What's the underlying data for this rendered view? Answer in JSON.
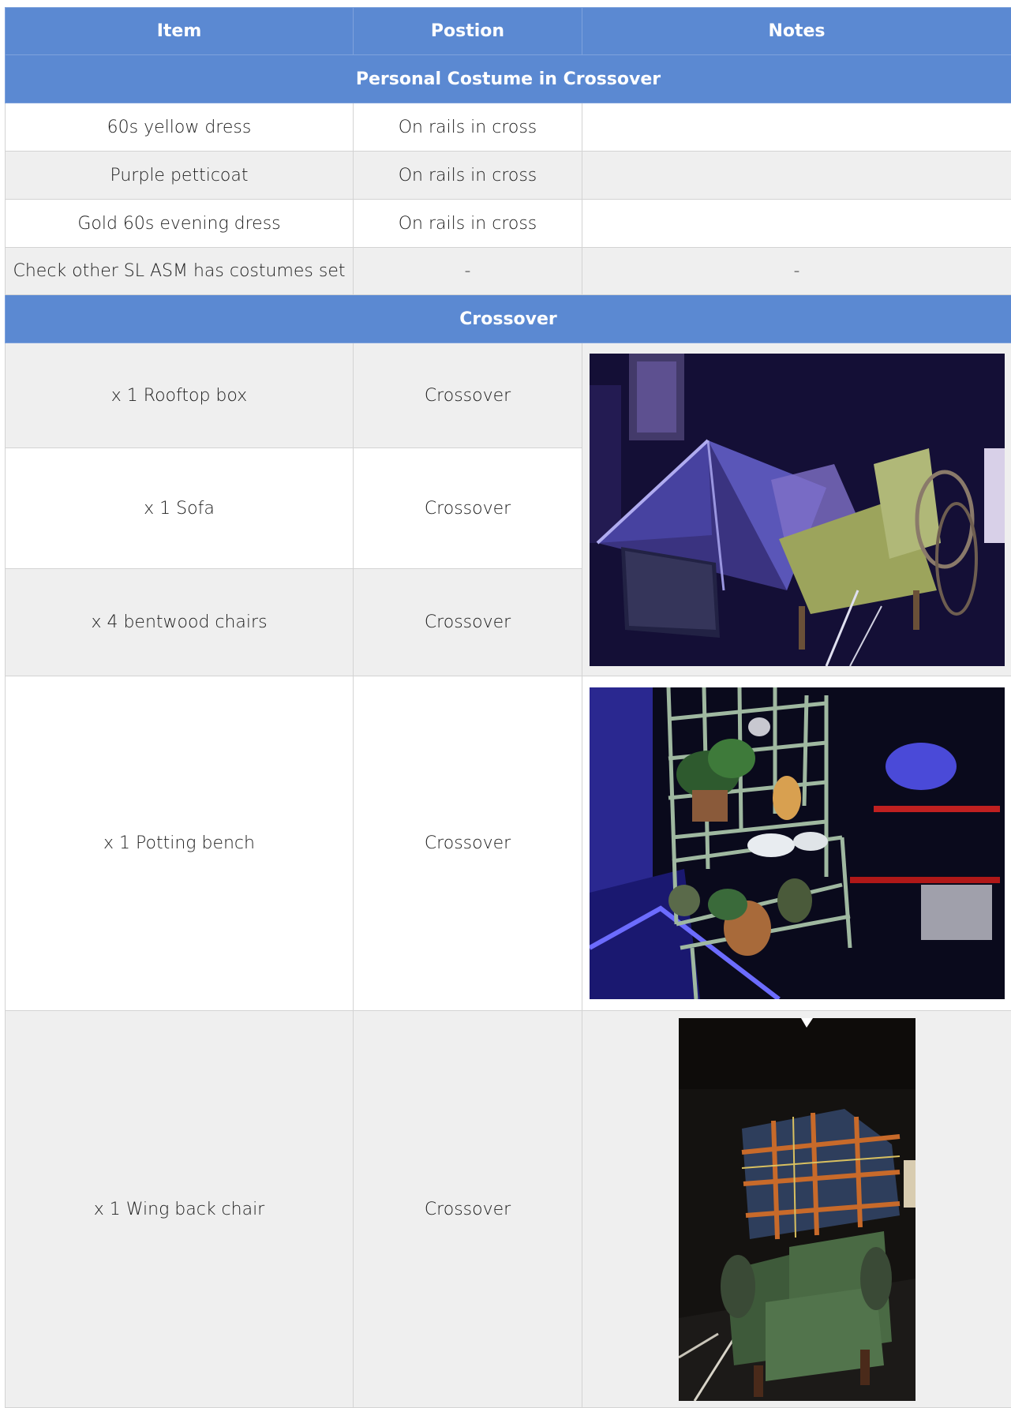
{
  "table": {
    "headers": [
      "Item",
      "Postion",
      "Notes"
    ],
    "sections": [
      {
        "title": "Personal Costume in Crossover",
        "rows": [
          {
            "item": "60s yellow dress",
            "position": "On rails in cross",
            "notes": ""
          },
          {
            "item": "Purple petticoat",
            "position": "On rails in cross",
            "notes": ""
          },
          {
            "item": "Gold 60s evening dress",
            "position": "On rails in cross",
            "notes": ""
          },
          {
            "item": "Check other SL ASM has costumes set",
            "position": "-",
            "notes": "-"
          }
        ]
      },
      {
        "title": "Crossover",
        "rows": [
          {
            "item": "x 1 Rooftop box",
            "position": "Crossover"
          },
          {
            "item": "x 1 Sofa",
            "position": "Crossover"
          },
          {
            "item": "x 4 bentwood chairs",
            "position": "Crossover"
          },
          {
            "item": "x 1 Potting bench",
            "position": "Crossover"
          },
          {
            "item": "x 1 Wing back chair",
            "position": "Crossover"
          }
        ]
      }
    ]
  },
  "colors": {
    "header_blue": "#5b89d2",
    "row_shade": "#efefef",
    "grid": "#d3d3d3"
  }
}
